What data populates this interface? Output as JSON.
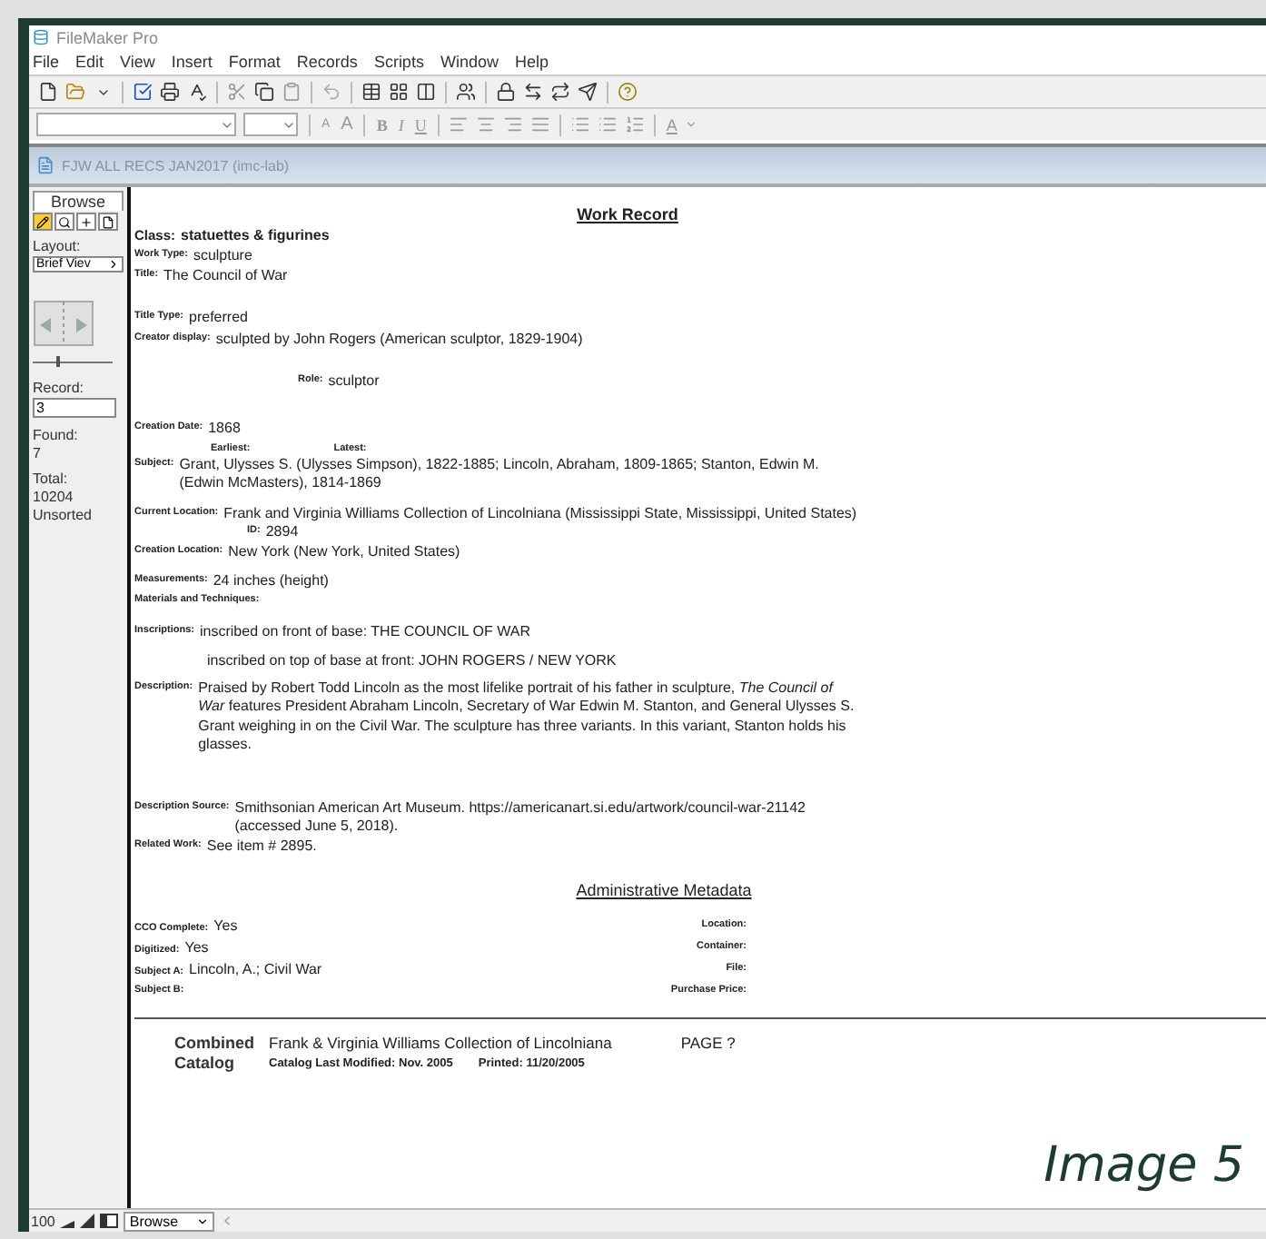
{
  "window": {
    "title": "FileMaker Pro"
  },
  "menu": [
    "File",
    "Edit",
    "View",
    "Insert",
    "Format",
    "Records",
    "Scripts",
    "Window",
    "Help"
  ],
  "format_toolbar": {
    "buttons": [
      "A",
      "A",
      "B",
      "I",
      "U",
      "A"
    ]
  },
  "document": {
    "title": "FJW ALL RECS JAN2017 (imc-lab)"
  },
  "sidebar": {
    "mode": "Browse",
    "layout_label": "Layout:",
    "layout_value": "Brief Viev",
    "record_slider": {
      "level": 0.3
    },
    "record_label": "Record:",
    "record_value": "3",
    "found_label": "Found:",
    "found_value": "7",
    "total_label": "Total:",
    "total_value": "10204",
    "sort_status": "Unsorted"
  },
  "record": {
    "heading": "Work Record",
    "fields": [
      {
        "kind": "field",
        "label": "Class:",
        "value": "statuettes & figurines"
      },
      {
        "kind": "field",
        "label": "Work Type:",
        "value": "sculpture"
      },
      {
        "kind": "field",
        "label": "Title:",
        "value": "The Council of War"
      },
      {
        "kind": "field",
        "label": "Title Type:",
        "value": "preferred"
      },
      {
        "kind": "field",
        "label": "Creator display:",
        "value": "sculpted by John Rogers (American sculptor, 1829-1904)"
      },
      {
        "kind": "sub",
        "label": "Role:",
        "value": "sculptor"
      },
      {
        "kind": "field",
        "label": "Creation Date:",
        "value": "1868"
      },
      {
        "kind": "pair",
        "label": "Earliest:",
        "value": "Latest:"
      },
      {
        "kind": "field",
        "label": "Subject:",
        "value": "Grant, Ulysses S. (Ulysses Simpson), 1822-1885; Lincoln, Abraham, 1809-1865; Stanton, Edwin M. (Edwin McMasters), 1814-1869"
      },
      {
        "kind": "field",
        "label": "Current Location:",
        "value": "Frank and Virginia Williams Collection of Lincolniana (Mississippi State, Mississippi, United States)"
      },
      {
        "kind": "sub",
        "label": "ID:",
        "value": "2894"
      },
      {
        "kind": "field",
        "label": "Creation Location:",
        "value": "New York (New York, United States)"
      },
      {
        "kind": "field",
        "label": "Measurements:",
        "value": "24 inches (height)"
      },
      {
        "kind": "field",
        "label": "Materials and Techniques:"
      },
      {
        "kind": "field",
        "label": "Inscriptions:",
        "value": "inscribed on front of base: THE COUNCIL OF WAR"
      },
      {
        "kind": "cont",
        "value": "inscribed on top of base at front: JOHN ROGERS / NEW YORK"
      },
      {
        "kind": "field",
        "label": "Description:",
        "value": "Praised by Robert Todd Lincoln as the most lifelike portrait of his father in sculpture, *The Council of War* features President Abraham Lincoln, Secretary of War Edwin M. Stanton, and General Ulysses S. Grant weighing in on the Civil War. The sculpture has three variants. In this variant, Stanton holds his glasses."
      },
      {
        "kind": "field",
        "label": "Description Source:",
        "value": "Smithsonian American Art Museum. https://americanart.si.edu/artwork/council-war-21142 (accessed June 5, 2018)."
      },
      {
        "kind": "field",
        "label": "Related Work:",
        "value": "See item # 2895."
      }
    ],
    "admin_heading": "Administrative Metadata",
    "admin_left": [
      {
        "label": "CCO Complete:",
        "value": "Yes"
      },
      {
        "label": "Digitized:",
        "value": "Yes"
      },
      {
        "label": "Subject A:",
        "value": "Lincoln, A.; Civil War"
      },
      {
        "label": "Subject B:"
      }
    ],
    "admin_right": [
      "Location:",
      "Container:",
      "File:",
      "Purchase Price:"
    ],
    "footer": {
      "title_line_1": "Combined",
      "title_line_2": "Catalog",
      "collection": "Frank & Virginia Williams Collection of Lincolniana",
      "page": "PAGE  ?",
      "modified": "Catalog Last Modified:  Nov. 2005",
      "printed": "Printed: 11/20/2005"
    }
  },
  "caption": "Image 5",
  "status_bar": {
    "zoom": "100",
    "mode": "Browse"
  }
}
